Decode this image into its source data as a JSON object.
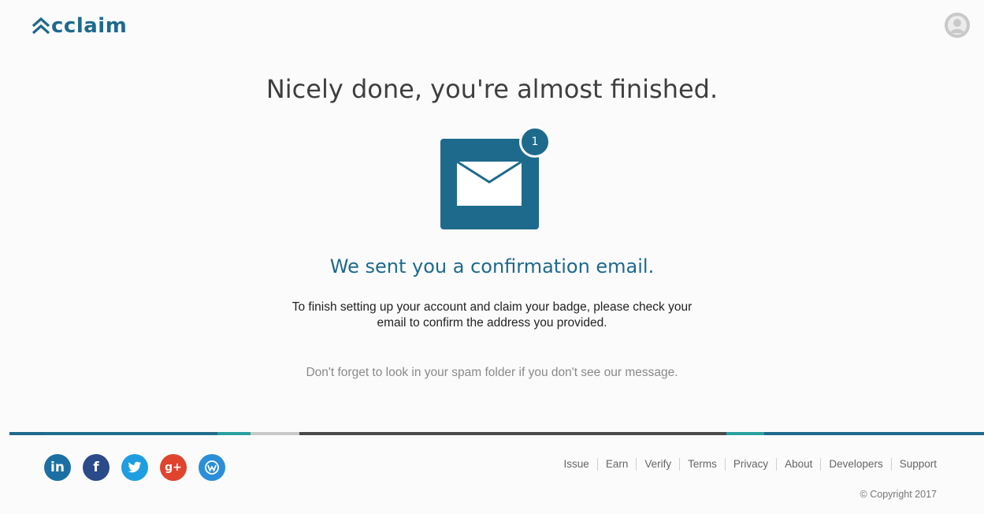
{
  "header": {
    "logo_text": "cclaim",
    "avatar_icon": "user-avatar-icon"
  },
  "main": {
    "headline": "Nicely done, you're almost finished.",
    "notification_count": "1",
    "mail_icon": "envelope-icon",
    "subhead": "We sent you a confirmation email.",
    "instructions_line1": "To finish setting up your account and claim your badge, please check your",
    "instructions_line2": "email to confirm the address you provided.",
    "spam_note": "Don't forget to look in your spam folder if you don't see our message."
  },
  "footer": {
    "social": [
      {
        "name": "linkedin-icon",
        "glyph": "in",
        "color": "#1b6fa3"
      },
      {
        "name": "facebook-icon",
        "glyph": "f",
        "color": "#2a4a8a"
      },
      {
        "name": "twitter-icon",
        "glyph": "t",
        "color": "#1e9ee0"
      },
      {
        "name": "google-plus-icon",
        "glyph": "g+",
        "color": "#e0442e"
      },
      {
        "name": "weibo-icon",
        "glyph": "w",
        "color": "#2a8fd8"
      }
    ],
    "links": [
      "Issue",
      "Earn",
      "Verify",
      "Terms",
      "Privacy",
      "About",
      "Developers",
      "Support"
    ],
    "copyright": "© Copyright 2017"
  },
  "colors": {
    "brand": "#1d6a8c",
    "accent_teal": "#2aa0a0",
    "bar_dark": "#4a4a4a",
    "bar_light": "#c8c8c8"
  }
}
